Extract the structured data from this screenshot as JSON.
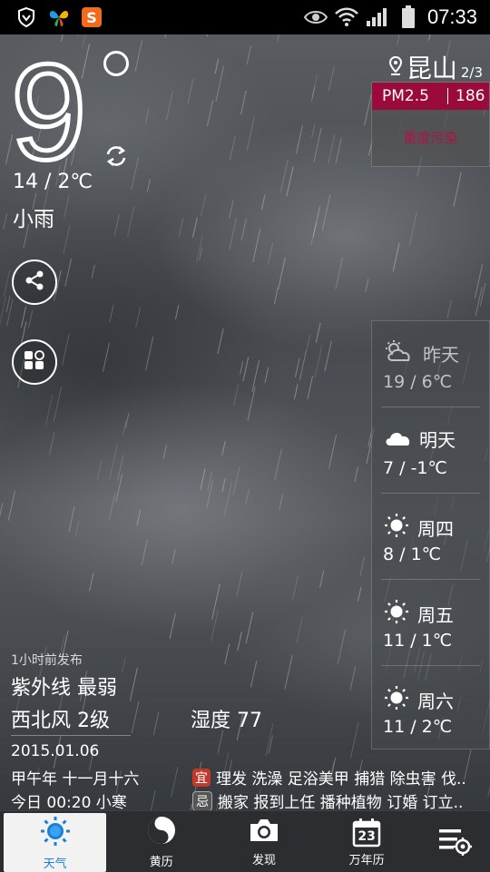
{
  "status_bar": {
    "time": "07:33"
  },
  "current": {
    "temperature": "9",
    "hi_lo": "14 / 2℃",
    "condition": "小雨"
  },
  "location": {
    "city": "昆山",
    "page": "2/3"
  },
  "air_quality": {
    "label": "PM2.5",
    "value": "186",
    "level": "重度污染",
    "accent": "#9a0b3b"
  },
  "forecast": [
    {
      "day": "昨天",
      "temp": "19 / 6℃",
      "icon": "partly-cloudy-icon",
      "dim": true
    },
    {
      "day": "明天",
      "temp": "7 / -1℃",
      "icon": "cloud-icon",
      "dim": false
    },
    {
      "day": "周四",
      "temp": "8 / 1℃",
      "icon": "sun-icon",
      "dim": false
    },
    {
      "day": "周五",
      "temp": "11 / 1℃",
      "icon": "sun-icon",
      "dim": false
    },
    {
      "day": "周六",
      "temp": "11 / 2℃",
      "icon": "sun-icon",
      "dim": false
    }
  ],
  "details": {
    "published": "1小时前发布",
    "uv": "紫外线 最弱",
    "wind": "西北风 2级",
    "humidity": "湿度 77"
  },
  "almanac": {
    "date": "2015.01.06",
    "lunar": "甲午年 十一月十六",
    "solar_term": "今日 00:20 小寒",
    "yi_tag": "宜",
    "yi": "理发 洗澡 足浴美甲 捕猎 除虫害 伐..",
    "ji_tag": "忌",
    "ji": "搬家 报到上任 播种植物 订婚 订立.."
  },
  "nav": {
    "items": [
      {
        "label": "天气",
        "icon": "sun-icon"
      },
      {
        "label": "黄历",
        "icon": "yin-yang-icon"
      },
      {
        "label": "发现",
        "icon": "camera-icon"
      },
      {
        "label": "万年历",
        "icon": "calendar-icon",
        "calendar_day": "23"
      }
    ]
  }
}
